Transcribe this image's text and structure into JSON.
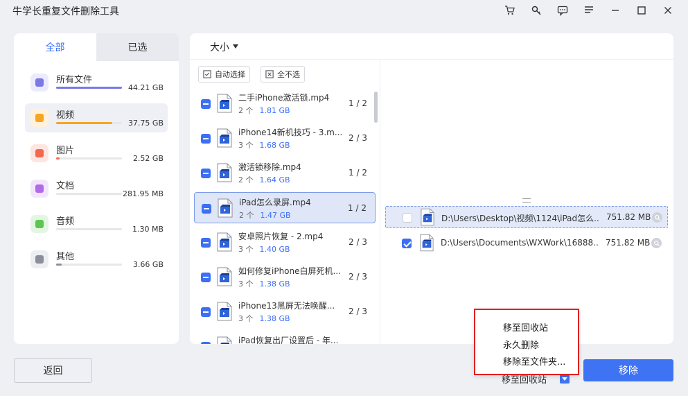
{
  "app": {
    "title": "牛学长重复文件删除工具"
  },
  "window_icons": [
    "cart-icon",
    "key-icon",
    "feedback-icon",
    "menu-icon",
    "minimize-icon",
    "maximize-icon",
    "close-icon"
  ],
  "left": {
    "tabs": [
      {
        "label": "全部",
        "active": true
      },
      {
        "label": "已选",
        "active": false
      }
    ],
    "categories": [
      {
        "name": "所有文件",
        "size": "44.21 GB",
        "fill": 1.0,
        "color": "#7b79e6",
        "bg": "#eceafd",
        "active": false
      },
      {
        "name": "视频",
        "size": "37.75 GB",
        "fill": 0.85,
        "color": "#f5a623",
        "bg": "#fff1dc",
        "active": true
      },
      {
        "name": "图片",
        "size": "2.52 GB",
        "fill": 0.05,
        "color": "#f06a4f",
        "bg": "#fde6e1",
        "active": false
      },
      {
        "name": "文档",
        "size": "281.95 MB",
        "fill": 0.0,
        "color": "#b26be8",
        "bg": "#f2e6fc",
        "active": false
      },
      {
        "name": "音频",
        "size": "1.30 MB",
        "fill": 0.0,
        "color": "#5ec552",
        "bg": "#e3f6e1",
        "active": false
      },
      {
        "name": "其他",
        "size": "3.66 GB",
        "fill": 0.08,
        "color": "#8a8f99",
        "bg": "#eceef1",
        "active": false
      }
    ]
  },
  "sort": {
    "label": "大小"
  },
  "toolbar": {
    "auto_select": "自动选择",
    "deselect_all": "全不选"
  },
  "groups": [
    {
      "name": "二手iPhone激活锁.mp4",
      "count": "2 个",
      "size": "1.81 GB",
      "selected": "1 / 2",
      "highlight": false
    },
    {
      "name": "iPhone14新机技巧 - 3.m...",
      "count": "3 个",
      "size": "1.68 GB",
      "selected": "2 / 3",
      "highlight": false
    },
    {
      "name": "激活锁移除.mp4",
      "count": "2 个",
      "size": "1.64 GB",
      "selected": "1 / 2",
      "highlight": false
    },
    {
      "name": "iPad怎么录屏.mp4",
      "count": "2 个",
      "size": "1.47 GB",
      "selected": "1 / 2",
      "highlight": true
    },
    {
      "name": "安卓照片恢复 - 2.mp4",
      "count": "3 个",
      "size": "1.40 GB",
      "selected": "2 / 3",
      "highlight": false
    },
    {
      "name": "如何修复iPhone白屏死机...",
      "count": "3 个",
      "size": "1.38 GB",
      "selected": "2 / 3",
      "highlight": false
    },
    {
      "name": "iPhone13黑屏无法唤醒...",
      "count": "3 个",
      "size": "1.38 GB",
      "selected": "2 / 3",
      "highlight": false
    },
    {
      "name": "iPad恢复出厂设置后 - 年...",
      "count": "",
      "size": "",
      "selected": "",
      "highlight": false
    }
  ],
  "duplicates": [
    {
      "path": "D:\\Users\\Desktop\\视频\\1124\\iPad怎么...",
      "size": "751.82 MB",
      "checked": false,
      "highlight": true
    },
    {
      "path": "D:\\Users\\Documents\\WXWork\\16888...",
      "size": "751.82 MB",
      "checked": true,
      "highlight": false
    }
  ],
  "bottom": {
    "back_label": "返回",
    "remove_label": "移除",
    "move_select_value": "移至回收站",
    "fragment": "移"
  },
  "dropdown": {
    "items": [
      "移至回收站",
      "永久删除",
      "移除至文件夹..."
    ]
  }
}
